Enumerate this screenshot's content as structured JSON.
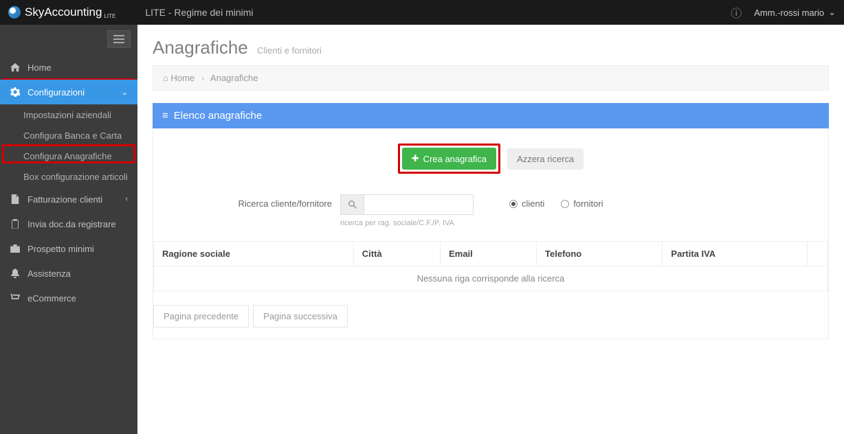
{
  "brand": {
    "name": "SkyAccounting",
    "sub": "LITE"
  },
  "top": {
    "center": "LITE - Regime dei minimi",
    "user": "Amm.-rossi mario"
  },
  "sidebar": {
    "items": [
      {
        "icon": "home",
        "label": "Home"
      },
      {
        "icon": "cogs",
        "label": "Configurazioni"
      },
      {
        "icon": "file",
        "label": "Fatturazione clienti"
      },
      {
        "icon": "clipboard",
        "label": "Invia doc.da registrare"
      },
      {
        "icon": "briefcase",
        "label": "Prospetto minimi"
      },
      {
        "icon": "bell",
        "label": "Assistenza"
      },
      {
        "icon": "cart",
        "label": "eCommerce"
      }
    ],
    "config_sub": [
      {
        "label": "Impostazioni aziendali"
      },
      {
        "label": "Configura Banca e Carta"
      },
      {
        "label": "Configura Anagrafiche"
      },
      {
        "label": "Box configurazione articoli"
      }
    ]
  },
  "page": {
    "title": "Anagrafiche",
    "subtitle": "Clienti e fornitori",
    "breadcrumb_home": "Home",
    "breadcrumb_current": "Anagrafiche",
    "panel_title": "Elenco anagrafiche"
  },
  "actions": {
    "create": "Crea anagrafica",
    "reset": "Azzera ricerca"
  },
  "search": {
    "label": "Ricerca cliente/fornitore",
    "hint": "ricerca per rag. sociale/C.F./P. IVA",
    "radio_clienti": "clienti",
    "radio_fornitori": "fornitori"
  },
  "table": {
    "headers": [
      "Ragione sociale",
      "Città",
      "Email",
      "Telefono",
      "Partita IVA"
    ],
    "empty": "Nessuna riga corrisponde alla ricerca"
  },
  "pager": {
    "prev": "Pagina precedente",
    "next": "Pagina successiva"
  }
}
